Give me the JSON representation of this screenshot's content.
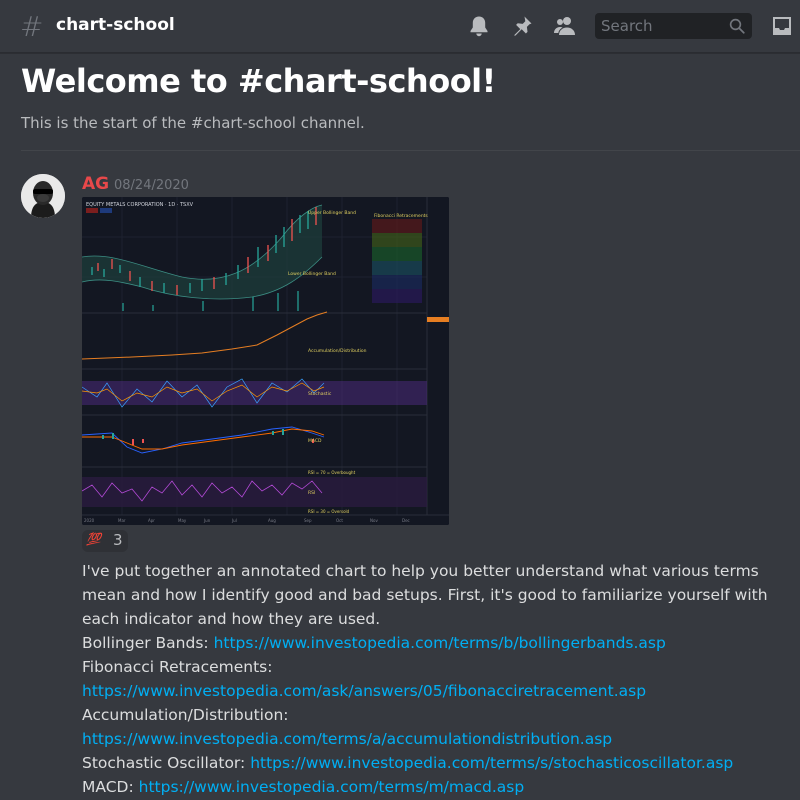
{
  "header": {
    "channel_name": "chart-school",
    "search_placeholder": "Search",
    "icons": [
      "bell-icon",
      "pin-icon",
      "members-icon",
      "search-icon",
      "inbox-icon"
    ]
  },
  "welcome": {
    "title": "Welcome to #chart-school!",
    "subtitle": "This is the start of the #chart-school channel."
  },
  "message": {
    "author": "AG",
    "author_color": "#e8484a",
    "timestamp": "08/24/2020",
    "reaction": {
      "emoji": "100-emoji",
      "emoji_text": "💯",
      "count": "3"
    },
    "intro": "I've put together an annotated chart to help you better understand what various terms mean and how I identify good and bad setups. First, it's good to familiarize yourself with each indicator and how they are used.",
    "links": [
      {
        "label": "Bollinger Bands:",
        "url": "https://www.investopedia.com/terms/b/bollingerbands.asp"
      },
      {
        "label": "Fibonacci Retracements:",
        "url": "https://www.investopedia.com/ask/answers/05/fibonacciretracement.asp"
      },
      {
        "label": "Accumulation/Distribution:",
        "url": "https://www.investopedia.com/terms/a/accumulationdistribution.asp"
      },
      {
        "label": "Stochastic Oscillator:",
        "url": "https://www.investopedia.com/terms/s/stochasticoscillator.asp"
      },
      {
        "label": "MACD:",
        "url": "https://www.investopedia.com/terms/m/macd.asp"
      }
    ]
  },
  "chart_image": {
    "title": "EQUITY METALS CORPORATION · 1D · TSXV",
    "annotations": {
      "upper_bb": "Upper Bollinger Band",
      "lower_bb": "Lower Bollinger Band",
      "fib": "Fibonacci Retracements",
      "accdist": "Accumulation/Distribution",
      "stoch": "Stochastic",
      "macd": "MACD",
      "rsi_over": "RSI = 70 = Overbought",
      "rsi": "RSI",
      "rsi_under": "RSI = 30 = Oversold"
    },
    "months": [
      "2020",
      "Mar",
      "Apr",
      "May",
      "Jun",
      "Jul",
      "Aug",
      "Sep",
      "Oct",
      "Nov",
      "Dec"
    ]
  }
}
